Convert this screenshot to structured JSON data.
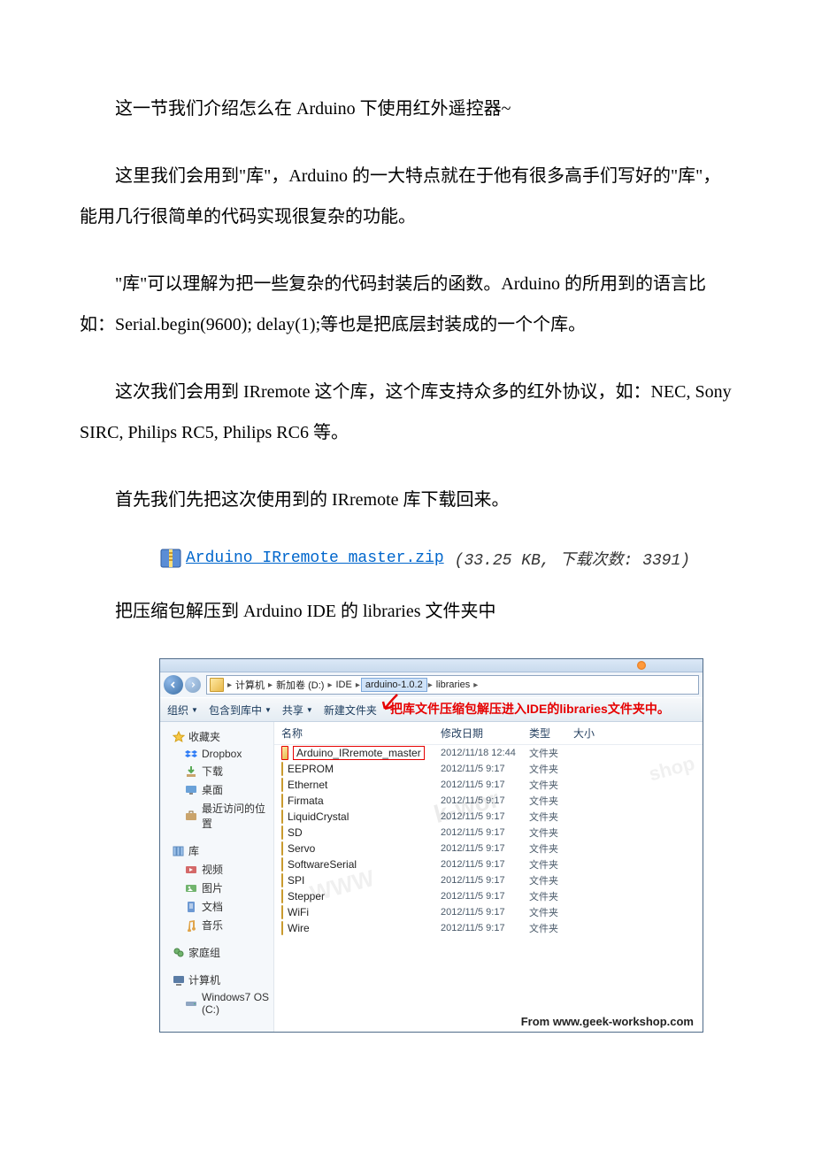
{
  "paragraphs": {
    "p1": "这一节我们介绍怎么在 Arduino 下使用红外遥控器~",
    "p2": "这里我们会用到\"库\"，Arduino 的一大特点就在于他有很多高手们写好的\"库\"，能用几行很简单的代码实现很复杂的功能。",
    "p3": "\"库\"可以理解为把一些复杂的代码封装后的函数。Arduino 的所用到的语言比如：Serial.begin(9600);  delay(1);等也是把底层封装成的一个个库。",
    "p4": "这次我们会用到 IRremote 这个库，这个库支持众多的红外协议，如：NEC, Sony SIRC, Philips RC5, Philips RC6 等。",
    "p5": "首先我们先把这次使用到的 IRremote 库下载回来。",
    "p6": "把压缩包解压到 Arduino IDE 的 libraries 文件夹中"
  },
  "download": {
    "link_text": "Arduino IRremote master.zip",
    "meta": "(33.25 KB, 下载次数: 3391)"
  },
  "explorer": {
    "breadcrumb": {
      "seg1": "计算机",
      "seg2": "新加卷 (D:)",
      "seg3": "IDE",
      "seg4": "arduino-1.0.2",
      "seg5": "libraries"
    },
    "toolbar": {
      "organize": "组织",
      "include": "包含到库中",
      "share": "共享",
      "newfolder": "新建文件夹"
    },
    "annotation": "把库文件压缩包解压进入IDE的libraries文件夹中。",
    "sidebar": {
      "favorites": "收藏夹",
      "dropbox": "Dropbox",
      "downloads": "下载",
      "desktop": "桌面",
      "recent": "最近访问的位置",
      "libraries": "库",
      "videos": "视频",
      "pictures": "图片",
      "documents": "文档",
      "music": "音乐",
      "homegroup": "家庭组",
      "computer": "计算机",
      "cdrive": "Windows7 OS (C:)"
    },
    "columns": {
      "name": "名称",
      "date": "修改日期",
      "type": "类型",
      "size": "大小"
    },
    "files": [
      {
        "name": "Arduino_IRremote_master",
        "date": "2012/11/18 12:44",
        "type": "文件夹",
        "selected": true
      },
      {
        "name": "EEPROM",
        "date": "2012/11/5 9:17",
        "type": "文件夹"
      },
      {
        "name": "Ethernet",
        "date": "2012/11/5 9:17",
        "type": "文件夹"
      },
      {
        "name": "Firmata",
        "date": "2012/11/5 9:17",
        "type": "文件夹"
      },
      {
        "name": "LiquidCrystal",
        "date": "2012/11/5 9:17",
        "type": "文件夹"
      },
      {
        "name": "SD",
        "date": "2012/11/5 9:17",
        "type": "文件夹"
      },
      {
        "name": "Servo",
        "date": "2012/11/5 9:17",
        "type": "文件夹"
      },
      {
        "name": "SoftwareSerial",
        "date": "2012/11/5 9:17",
        "type": "文件夹"
      },
      {
        "name": "SPI",
        "date": "2012/11/5 9:17",
        "type": "文件夹"
      },
      {
        "name": "Stepper",
        "date": "2012/11/5 9:17",
        "type": "文件夹"
      },
      {
        "name": "WiFi",
        "date": "2012/11/5 9:17",
        "type": "文件夹"
      },
      {
        "name": "Wire",
        "date": "2012/11/5 9:17",
        "type": "文件夹"
      }
    ],
    "watermark_short": "k-wor",
    "watermark_www": "WWW",
    "watermark_shop": "shop",
    "brand": "From www.geek-workshop.com"
  }
}
